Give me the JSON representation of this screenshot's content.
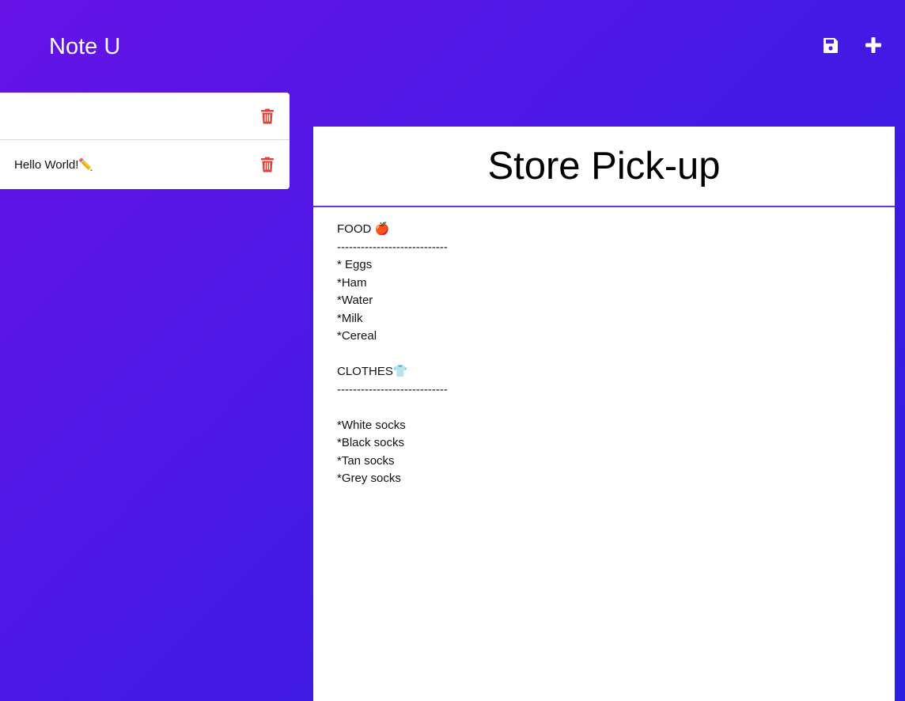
{
  "app": {
    "title": "Note U"
  },
  "toolbar": {
    "save_icon": "floppy-disk-icon",
    "add_icon": "plus-icon"
  },
  "notes": [
    {
      "title": "",
      "delete_icon": "trash-icon"
    },
    {
      "title": "Hello World!✏️",
      "delete_icon": "trash-icon"
    }
  ],
  "editor": {
    "title": "Store Pick-up",
    "lines": [
      "FOOD 🍎",
      "----------------------------",
      "* Eggs",
      "*Ham",
      "*Water",
      "*Milk",
      "*Cereal",
      "",
      "CLOTHES👕",
      "----------------------------",
      "",
      "*White socks",
      "*Black socks",
      "*Tan socks",
      "*Grey socks"
    ]
  },
  "colors": {
    "accent": "#6a34e8",
    "trash": "#d9453a",
    "gradient_start": "#6613e6",
    "gradient_end": "#2a1fe0"
  }
}
